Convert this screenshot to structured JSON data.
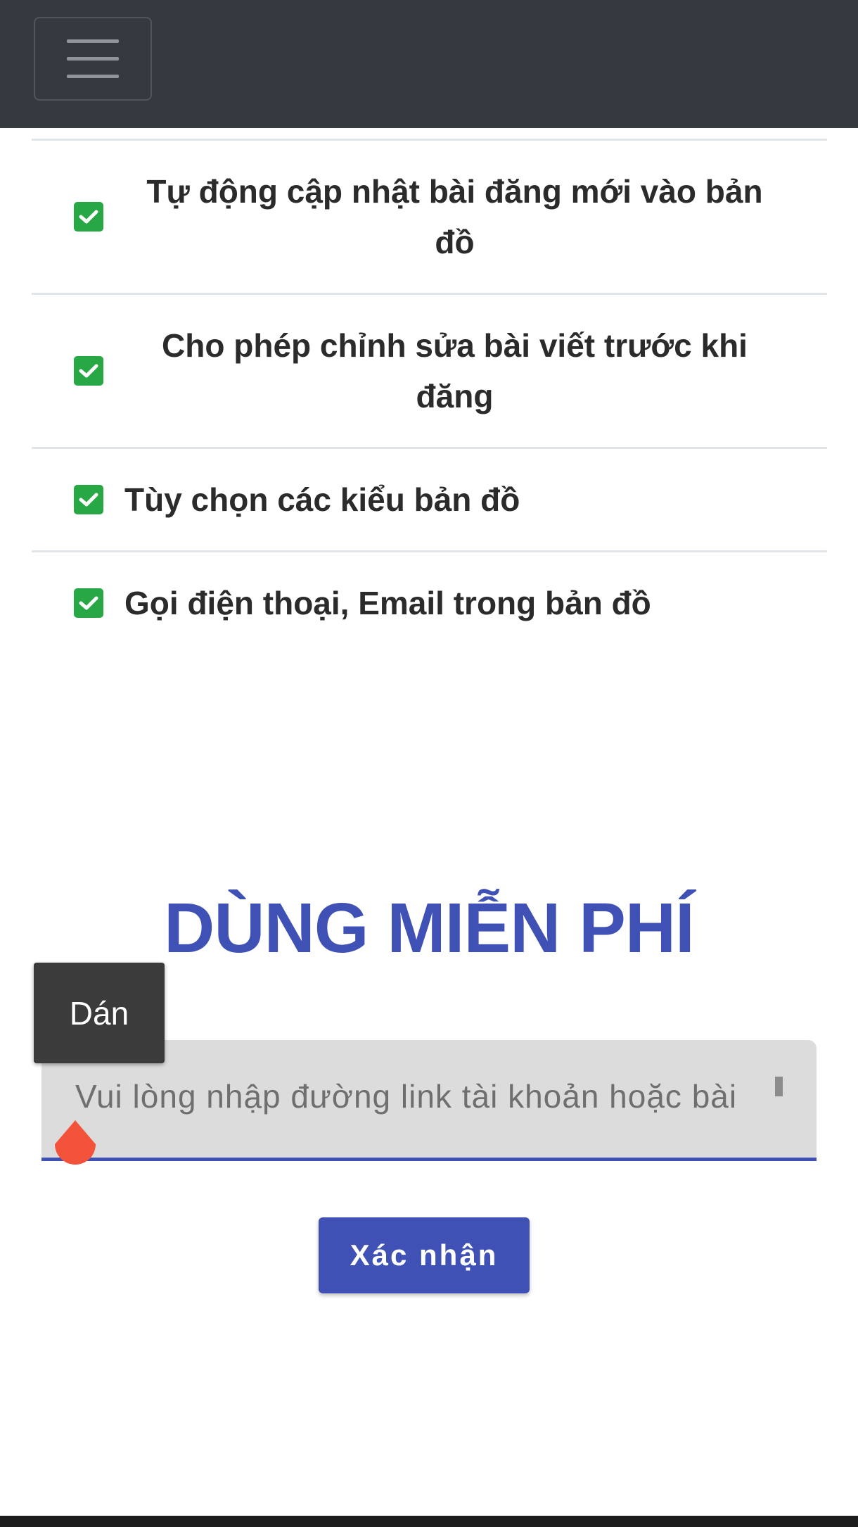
{
  "navbar": {
    "menu_icon": "hamburger-menu-icon",
    "color": "#343a40"
  },
  "features": [
    {
      "label": "Tự động cập nhật bài đăng mới vào bản đồ",
      "icon": "check-square-icon"
    },
    {
      "label": "Cho phép chỉnh sửa bài viết trước khi đăng",
      "icon": "check-square-icon"
    },
    {
      "label": "Tùy chọn các kiểu bản đồ",
      "icon": "check-square-icon"
    },
    {
      "label": "Gọi điện thoại, Email trong bản đồ",
      "icon": "check-square-icon"
    }
  ],
  "free_section": {
    "title": "DÙNG MIỄN PHÍ",
    "input_placeholder": "Vui lòng nhập đường link tài khoản hoặc bài",
    "input_value": "",
    "confirm_label": "Xác nhận"
  },
  "context_menu": {
    "paste_label": "Dán"
  },
  "colors": {
    "accent": "#3f51b5",
    "check": "#28a745",
    "text_cursor_handle": "#f4533b"
  }
}
